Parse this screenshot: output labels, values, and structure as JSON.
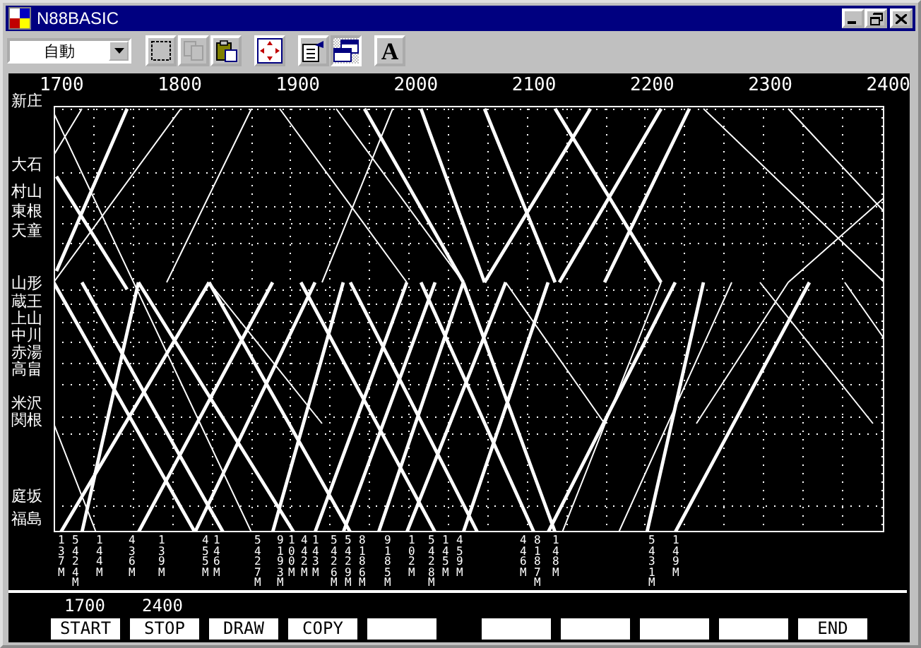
{
  "window": {
    "title": "N88BASIC"
  },
  "toolbar": {
    "mode_dropdown": {
      "value": "自動"
    },
    "buttons": [
      {
        "kind": "select",
        "disabled": false,
        "pressed": false
      },
      {
        "kind": "copy",
        "disabled": true,
        "pressed": false
      },
      {
        "kind": "paste",
        "disabled": false,
        "pressed": false
      },
      {
        "kind": "fullscreen",
        "disabled": false,
        "pressed": false
      },
      {
        "kind": "properties",
        "disabled": false,
        "pressed": false
      },
      {
        "kind": "window",
        "disabled": false,
        "pressed": true
      },
      {
        "kind": "font",
        "label": "A",
        "disabled": false,
        "pressed": false
      }
    ]
  },
  "diagram": {
    "time_labels": [
      "1700",
      "1800",
      "1900",
      "2000",
      "2100",
      "2200",
      "2300",
      "2400"
    ],
    "stations": [
      "新庄",
      "大石",
      "村山",
      "東根",
      "天童",
      "山形",
      "蔵王",
      "上山",
      "中川",
      "赤湯",
      "高畠",
      "米沢",
      "関根",
      "庭坂",
      "福島"
    ],
    "trains": [
      "137M",
      "5424M",
      "144M",
      "436M",
      "139M",
      "455M",
      "146M",
      "5427M",
      "9193M",
      "100M",
      "442M",
      "143M",
      "5426M",
      "5429M",
      "8186M",
      "9185M",
      "102M",
      "5428M",
      "145M",
      "459M",
      "446M",
      "8187M",
      "148M",
      "5431M",
      "149M"
    ]
  },
  "range": {
    "start": "1700",
    "stop": "2400"
  },
  "function_keys": [
    {
      "kind": "key",
      "label": "START"
    },
    {
      "kind": "key",
      "label": "STOP"
    },
    {
      "kind": "key",
      "label": "DRAW"
    },
    {
      "kind": "key",
      "label": "COPY"
    },
    {
      "kind": "blank"
    },
    {
      "kind": "blank"
    },
    {
      "kind": "blank"
    },
    {
      "kind": "blank"
    },
    {
      "kind": "blank"
    },
    {
      "kind": "key",
      "label": "END"
    }
  ]
}
